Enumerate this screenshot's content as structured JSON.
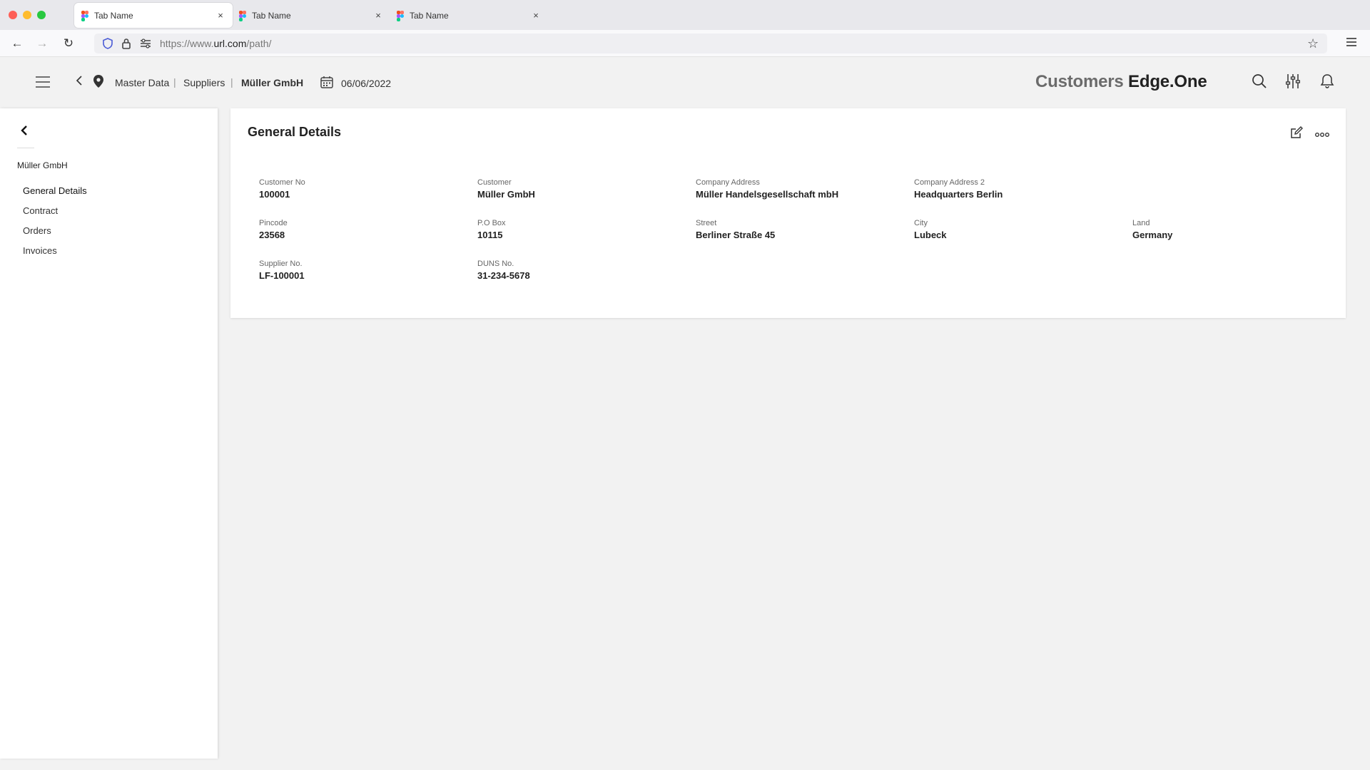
{
  "browser": {
    "tabs": [
      {
        "label": "Tab Name",
        "close": "×"
      },
      {
        "label": "Tab Name",
        "close": "×"
      },
      {
        "label": "Tab Name",
        "close": "×"
      }
    ],
    "url_prefix": "https://www.",
    "url_host": "url.com",
    "url_path": "/path/"
  },
  "header": {
    "breadcrumb": [
      "Master Data",
      "Suppliers",
      "Müller GmbH"
    ],
    "date": "06/06/2022",
    "brand_primary": "Customers",
    "brand_secondary": "Edge.One"
  },
  "sidebar": {
    "company": "Müller GmbH",
    "items": [
      "General Details",
      "Contract",
      "Orders",
      "Invoices"
    ]
  },
  "card": {
    "title": "General Details",
    "fields": [
      {
        "label": "Customer No",
        "value": "100001"
      },
      {
        "label": "Customer",
        "value": "Müller GmbH"
      },
      {
        "label": "Company Address",
        "value": "Müller Handelsgesellschaft mbH"
      },
      {
        "label": "Company Address 2",
        "value": "Headquarters Berlin"
      },
      {
        "label": "Pincode",
        "value": "23568"
      },
      {
        "label": "P.O Box",
        "value": "10115"
      },
      {
        "label": "Street",
        "value": "Berliner Straße 45"
      },
      {
        "label": "City",
        "value": "Lubeck"
      },
      {
        "label": "Land",
        "value": "Germany"
      },
      {
        "label": "Supplier No.",
        "value": "LF-100001"
      },
      {
        "label": "DUNS No.",
        "value": "31-234-5678"
      }
    ]
  },
  "colors": {
    "background": "#f2f2f2",
    "card": "#ffffff",
    "text": "#222222",
    "brand_muted": "#6b6b6b"
  }
}
